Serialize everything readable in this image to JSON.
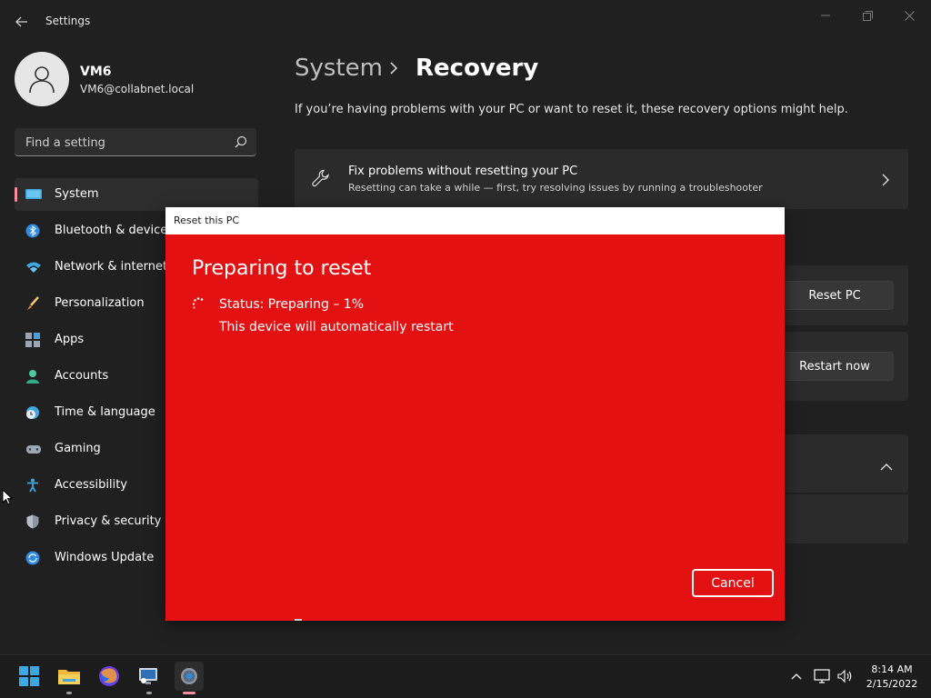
{
  "window": {
    "title": "Settings",
    "back_icon": "back-arrow-icon",
    "controls": [
      "minimize-icon",
      "restore-icon",
      "close-icon"
    ]
  },
  "profile": {
    "name": "VM6",
    "email": "VM6@collabnet.local",
    "avatar_icon": "user-avatar-icon"
  },
  "search": {
    "placeholder": "Find a setting",
    "value": "",
    "icon": "search-icon"
  },
  "sidebar": {
    "items": [
      {
        "label": "System",
        "icon": "system-display-icon",
        "selected": true
      },
      {
        "label": "Bluetooth & devices",
        "icon": "bluetooth-icon"
      },
      {
        "label": "Network & internet",
        "icon": "wifi-icon"
      },
      {
        "label": "Personalization",
        "icon": "paintbrush-icon"
      },
      {
        "label": "Apps",
        "icon": "apps-icon"
      },
      {
        "label": "Accounts",
        "icon": "accounts-icon"
      },
      {
        "label": "Time & language",
        "icon": "clock-globe-icon"
      },
      {
        "label": "Gaming",
        "icon": "gamepad-icon"
      },
      {
        "label": "Accessibility",
        "icon": "accessibility-icon"
      },
      {
        "label": "Privacy & security",
        "icon": "shield-icon"
      },
      {
        "label": "Windows Update",
        "icon": "update-icon"
      }
    ]
  },
  "main": {
    "breadcrumb_parent": "System",
    "breadcrumb_current": "Recovery",
    "intro": "If you’re having problems with your PC or want to reset it, these recovery options might help.",
    "fix_card": {
      "title": "Fix problems without resetting your PC",
      "subtitle": "Resetting can take a while — first, try resolving issues by running a troubleshooter",
      "icon": "wrench-icon"
    },
    "reset_button": "Reset PC",
    "restart_button": "Restart now"
  },
  "dialog": {
    "title": "Reset this PC",
    "heading": "Preparing to reset",
    "status": "Status: Preparing – 1%",
    "progress_percent": 1,
    "note": "This device will automatically restart",
    "cancel_label": "Cancel",
    "background_color": "#e31111"
  },
  "taskbar": {
    "icons": [
      "windows-start-icon",
      "file-explorer-icon",
      "firefox-icon",
      "remote-desktop-icon",
      "settings-gear-icon"
    ],
    "time": "8:14 AM",
    "date": "2/15/2022"
  },
  "colors": {
    "background": "#202020",
    "accent": "#ff8fa0",
    "dialog_red": "#e31111"
  }
}
